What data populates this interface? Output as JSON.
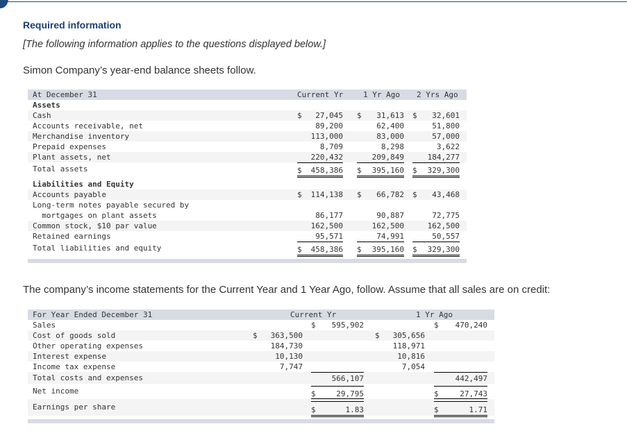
{
  "header": {
    "required_label": "Required information",
    "note": "[The following information applies to the questions displayed below.]",
    "intro_balance": "Simon Company’s year-end balance sheets follow.",
    "intro_income": "The company’s income statements for the Current Year and 1 Year Ago, follow. Assume that all sales are on credit:"
  },
  "balance_sheet": {
    "heading": "At December 31",
    "columns": [
      "Current Yr",
      "1 Yr Ago",
      "2 Yrs Ago"
    ],
    "sections": {
      "assets_label": "Assets",
      "liabilities_label": "Liabilities and Equity"
    },
    "rows": [
      {
        "label": "Cash",
        "values": [
          {
            "d": "$",
            "v": "27,045"
          },
          {
            "d": "$",
            "v": "31,613"
          },
          {
            "d": "$",
            "v": "32,601"
          }
        ]
      },
      {
        "label": "Accounts receivable, net",
        "values": [
          {
            "d": "",
            "v": "89,200"
          },
          {
            "d": "",
            "v": "62,400"
          },
          {
            "d": "",
            "v": "51,800"
          }
        ]
      },
      {
        "label": "Merchandise inventory",
        "values": [
          {
            "d": "",
            "v": "113,000"
          },
          {
            "d": "",
            "v": "83,000"
          },
          {
            "d": "",
            "v": "57,000"
          }
        ]
      },
      {
        "label": "Prepaid expenses",
        "values": [
          {
            "d": "",
            "v": "8,709"
          },
          {
            "d": "",
            "v": "8,298"
          },
          {
            "d": "",
            "v": "3,622"
          }
        ]
      },
      {
        "label": "Plant assets, net",
        "values": [
          {
            "d": "",
            "v": "220,432"
          },
          {
            "d": "",
            "v": "209,849"
          },
          {
            "d": "",
            "v": "184,277"
          }
        ]
      },
      {
        "label": "Total assets",
        "values": [
          {
            "d": "$",
            "v": "458,386"
          },
          {
            "d": "$",
            "v": "395,160"
          },
          {
            "d": "$",
            "v": "329,300"
          }
        ]
      },
      {
        "label": "Accounts payable",
        "values": [
          {
            "d": "$",
            "v": "114,138"
          },
          {
            "d": "$",
            "v": "66,782"
          },
          {
            "d": "$",
            "v": "43,468"
          }
        ]
      },
      {
        "label": "Long-term notes payable secured by",
        "label2": "  mortgages on plant assets",
        "values": [
          {
            "d": "",
            "v": "86,177"
          },
          {
            "d": "",
            "v": "90,887"
          },
          {
            "d": "",
            "v": "72,775"
          }
        ]
      },
      {
        "label": "Common stock, $10 par value",
        "values": [
          {
            "d": "",
            "v": "162,500"
          },
          {
            "d": "",
            "v": "162,500"
          },
          {
            "d": "",
            "v": "162,500"
          }
        ]
      },
      {
        "label": "Retained earnings",
        "values": [
          {
            "d": "",
            "v": "95,571"
          },
          {
            "d": "",
            "v": "74,991"
          },
          {
            "d": "",
            "v": "50,557"
          }
        ]
      },
      {
        "label": "Total liabilities and equity",
        "values": [
          {
            "d": "$",
            "v": "458,386"
          },
          {
            "d": "$",
            "v": "395,160"
          },
          {
            "d": "$",
            "v": "329,300"
          }
        ]
      }
    ]
  },
  "income_statement": {
    "heading": "For Year Ended December 31",
    "columns": [
      "Current Yr",
      "1 Yr Ago"
    ],
    "rows": [
      {
        "label": "Sales",
        "cur_inner": null,
        "cur_outer": {
          "d": "$",
          "v": "595,902"
        },
        "ago_inner": null,
        "ago_outer": {
          "d": "$",
          "v": "470,240"
        }
      },
      {
        "label": "Cost of goods sold",
        "cur_inner": {
          "d": "$",
          "v": "363,500"
        },
        "cur_outer": null,
        "ago_inner": {
          "d": "$",
          "v": "305,656"
        },
        "ago_outer": null
      },
      {
        "label": "Other operating expenses",
        "cur_inner": {
          "d": "",
          "v": "184,730"
        },
        "cur_outer": null,
        "ago_inner": {
          "d": "",
          "v": "118,971"
        },
        "ago_outer": null
      },
      {
        "label": "Interest expense",
        "cur_inner": {
          "d": "",
          "v": "10,130"
        },
        "cur_outer": null,
        "ago_inner": {
          "d": "",
          "v": "10,816"
        },
        "ago_outer": null
      },
      {
        "label": "Income tax expense",
        "cur_inner": {
          "d": "",
          "v": "7,747"
        },
        "cur_outer": null,
        "ago_inner": {
          "d": "",
          "v": "7,054"
        },
        "ago_outer": null
      },
      {
        "label": "Total costs and expenses",
        "cur_inner": null,
        "cur_outer": {
          "d": "",
          "v": "566,107"
        },
        "ago_inner": null,
        "ago_outer": {
          "d": "",
          "v": "442,497"
        }
      },
      {
        "label": "Net income",
        "cur_inner": null,
        "cur_outer": {
          "d": "$",
          "v": "29,795"
        },
        "ago_inner": null,
        "ago_outer": {
          "d": "$",
          "v": "27,743"
        }
      },
      {
        "label": "Earnings per share",
        "cur_inner": null,
        "cur_outer": {
          "d": "$",
          "v": "1.83"
        },
        "ago_inner": null,
        "ago_outer": {
          "d": "$",
          "v": "1.71"
        }
      }
    ]
  }
}
